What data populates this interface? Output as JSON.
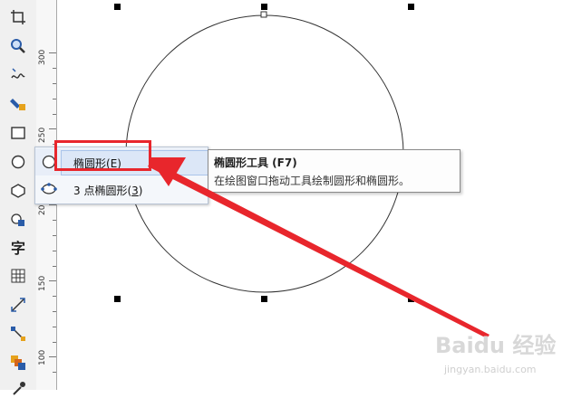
{
  "toolbox": {
    "tools": [
      {
        "name": "crop-tool-icon"
      },
      {
        "name": "zoom-tool-icon"
      },
      {
        "name": "freehand-tool-icon"
      },
      {
        "name": "smart-fill-tool-icon"
      },
      {
        "name": "rectangle-tool-icon"
      },
      {
        "name": "ellipse-tool-icon"
      },
      {
        "name": "polygon-tool-icon"
      },
      {
        "name": "basic-shapes-tool-icon"
      },
      {
        "name": "text-tool-icon",
        "glyph": "字"
      },
      {
        "name": "table-tool-icon"
      },
      {
        "name": "dimension-tool-icon"
      },
      {
        "name": "connector-tool-icon"
      },
      {
        "name": "blend-tool-icon"
      },
      {
        "name": "eyedropper-tool-icon"
      }
    ]
  },
  "ruler": {
    "labels": [
      "300",
      "250",
      "200",
      "150",
      "100"
    ]
  },
  "flyout": {
    "items": [
      {
        "label": "椭圆形(",
        "mnemonic": "E",
        "label_end": ")",
        "shortcut": "F7"
      },
      {
        "label": "3 点椭圆形(",
        "mnemonic": "3",
        "label_end": ")"
      }
    ]
  },
  "tooltip": {
    "title": "椭圆形工具 (F7)",
    "description": "在绘图窗口拖动工具绘制圆形和椭圆形。"
  },
  "watermark": {
    "logo_text": "Baidu 经验",
    "url_text": "jingyan.baidu.com"
  },
  "colors": {
    "annotation_red": "#e8262c",
    "highlight": "#dce7f7"
  }
}
